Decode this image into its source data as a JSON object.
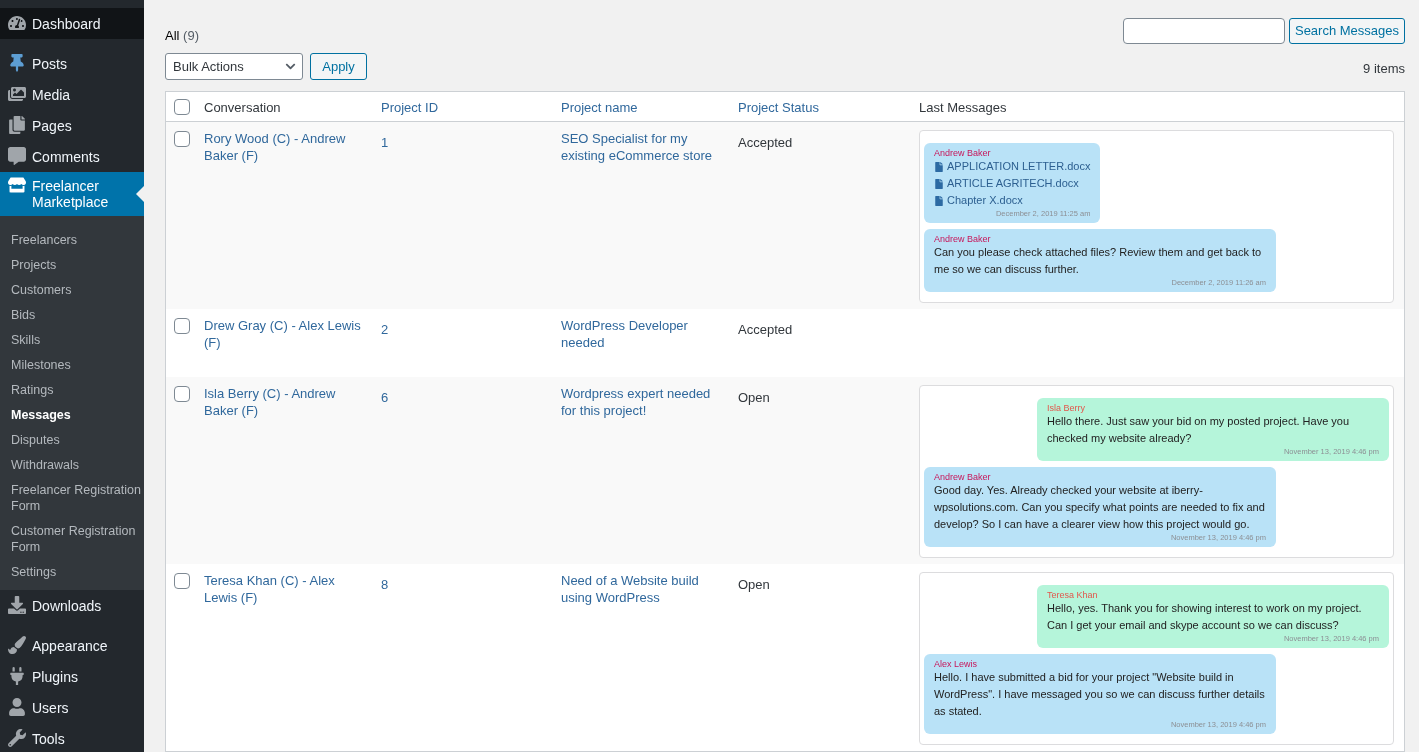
{
  "sidebar": {
    "groups": [
      [
        {
          "label": "Dashboard",
          "hovered": true,
          "selected": false
        }
      ],
      [
        {
          "label": "Posts",
          "hovered": false,
          "selected": false
        },
        {
          "label": "Media",
          "hovered": false,
          "selected": false
        },
        {
          "label": "Pages",
          "hovered": false,
          "selected": false
        },
        {
          "label": "Comments",
          "hovered": false,
          "selected": false
        },
        {
          "label": "Freelancer Marketplace",
          "hovered": false,
          "selected": true,
          "children": [
            {
              "label": "Freelancers",
              "selected": false
            },
            {
              "label": "Projects",
              "selected": false
            },
            {
              "label": "Customers",
              "selected": false
            },
            {
              "label": "Bids",
              "selected": false
            },
            {
              "label": "Skills",
              "selected": false
            },
            {
              "label": "Milestones",
              "selected": false
            },
            {
              "label": "Ratings",
              "selected": false
            },
            {
              "label": "Messages",
              "selected": true
            },
            {
              "label": "Disputes",
              "selected": false
            },
            {
              "label": "Withdrawals",
              "selected": false
            },
            {
              "label": "Freelancer Registration Form",
              "selected": false
            },
            {
              "label": "Customer Registration Form",
              "selected": false
            },
            {
              "label": "Settings",
              "selected": false
            }
          ]
        },
        {
          "label": "Downloads",
          "hovered": false,
          "selected": false
        }
      ],
      [
        {
          "label": "Appearance",
          "hovered": false,
          "selected": false
        },
        {
          "label": "Plugins",
          "hovered": false,
          "selected": false
        },
        {
          "label": "Users",
          "hovered": false,
          "selected": false
        },
        {
          "label": "Tools",
          "hovered": false,
          "selected": false
        }
      ]
    ]
  },
  "filters": [
    {
      "label": "All",
      "count": "(9)",
      "selected": true
    }
  ],
  "bulk_actions": {
    "value": "Bulk Actions"
  },
  "apply_button": "Apply",
  "search": {
    "button": "Search Messages"
  },
  "items_count": "9 items",
  "table": {
    "select_all": {
      "checked": false
    },
    "columns": [
      {
        "label": "Conversation",
        "sortable": false
      },
      {
        "label": "Project ID",
        "sortable": true
      },
      {
        "label": "Project name",
        "sortable": true
      },
      {
        "label": "Project Status",
        "sortable": true
      },
      {
        "label": "Last Messages",
        "sortable": false
      }
    ],
    "rows": [
      {
        "checked": false,
        "conversation": "Rory Wood (C) - Andrew Baker (F)",
        "project_id": "1",
        "project_name": "SEO Specialist for my existing eCommerce store",
        "status": "Accepted",
        "messages": [
          {
            "kind": "freelancer",
            "sender": "Andrew Baker",
            "files": [
              "APPLICATION LETTER.docx",
              "ARTICLE AGRITECH.docx",
              "Chapter X.docx"
            ],
            "time": "December 2, 2019 11:25 am"
          },
          {
            "kind": "freelancer",
            "sender": "Andrew Baker",
            "text": "Can you please check attached files? Review them and get back to me so we can discuss further.",
            "time": "December 2, 2019 11:26 am"
          }
        ]
      },
      {
        "checked": false,
        "conversation": "Drew Gray (C) - Alex Lewis (F)",
        "project_id": "2",
        "project_name": "WordPress Developer needed",
        "status": "Accepted"
      },
      {
        "checked": false,
        "conversation": "Isla Berry (C) - Andrew Baker (F)",
        "project_id": "6",
        "project_name": "Wordpress expert needed for this project!",
        "status": "Open",
        "messages": [
          {
            "kind": "customer",
            "sender": "Isla Berry",
            "text": "Hello there. Just saw your bid on my posted project. Have you checked my website already?",
            "time": "November 13, 2019 4:46 pm"
          },
          {
            "kind": "freelancer",
            "sender": "Andrew Baker",
            "text": "Good day. Yes. Already checked your website at iberry-wpsolutions.com. Can you specify what points are needed to fix and develop? So I can have a clearer view how this project would go.",
            "time": "November 13, 2019 4:46 pm"
          }
        ]
      },
      {
        "checked": false,
        "conversation": "Teresa Khan (C) - Alex Lewis (F)",
        "project_id": "8",
        "project_name": "Need of a Website build using WordPress",
        "status": "Open",
        "messages": [
          {
            "kind": "customer",
            "sender": "Teresa Khan",
            "text": "Hello, yes. Thank you for showing interest to work on my project. Can I get your email and skype account so we can discuss?",
            "time": "November 13, 2019 4:46 pm"
          },
          {
            "kind": "freelancer",
            "sender": "Alex Lewis",
            "text": "Hello. I have submitted a bid for your project \"Website build in WordPress\". I have messaged you so we can discuss further details as stated.",
            "time": "November 13, 2019 4:46 pm"
          }
        ]
      }
    ]
  }
}
